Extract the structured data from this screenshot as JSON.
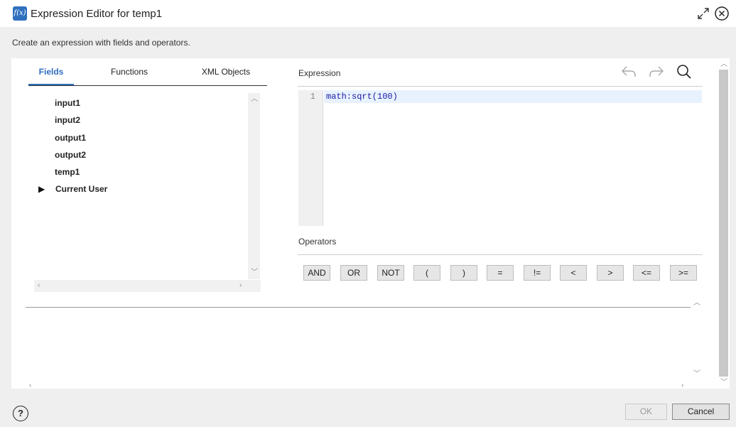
{
  "window": {
    "title": "Expression Editor for temp1",
    "app_icon_label": "f(x)",
    "subtitle": "Create an expression with fields and operators."
  },
  "tabs": [
    {
      "label": "Fields",
      "active": true
    },
    {
      "label": "Functions",
      "active": false
    },
    {
      "label": "XML Objects",
      "active": false
    }
  ],
  "fields": [
    {
      "label": "input1"
    },
    {
      "label": "input2"
    },
    {
      "label": "output1"
    },
    {
      "label": "output2"
    },
    {
      "label": "temp1"
    },
    {
      "label": "Current User",
      "expandable": true
    }
  ],
  "expression": {
    "label": "Expression",
    "line_number": "1",
    "code": "math:sqrt(100)"
  },
  "operators": {
    "label": "Operators",
    "items": [
      "AND",
      "OR",
      "NOT",
      "(",
      ")",
      "=",
      "!=",
      "<",
      ">",
      "<=",
      ">="
    ]
  },
  "footer": {
    "help_label": "?",
    "ok_label": "OK",
    "ok_enabled": false,
    "cancel_label": "Cancel"
  },
  "icons": {
    "app": "function-icon",
    "maximize": "expand-icon",
    "close": "close-circle-icon",
    "undo": "undo-icon",
    "redo": "redo-icon",
    "search": "search-icon",
    "expand_arrow": "triangle-right-icon"
  },
  "colors": {
    "accent": "#2f6fbf",
    "code_text": "#1a1aa6",
    "active_line": "#e8f2fe"
  }
}
